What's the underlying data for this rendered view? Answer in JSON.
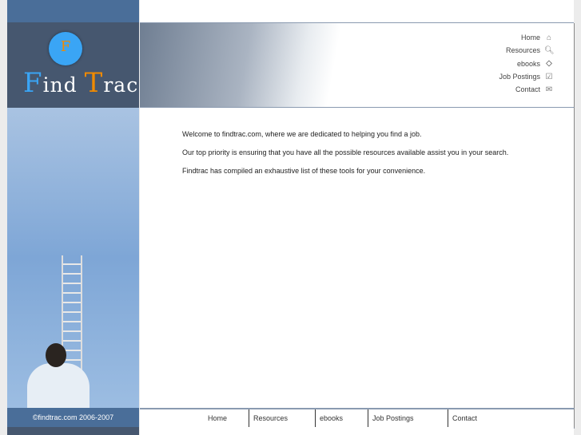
{
  "brand": {
    "logo_letter": "F",
    "name_first": "F",
    "name_rest1": "ind",
    "name_second": "T",
    "name_rest2": "rac"
  },
  "nav": [
    {
      "label": "Home",
      "icon": "home-icon"
    },
    {
      "label": "Resources",
      "icon": "search-icon"
    },
    {
      "label": "ebooks",
      "icon": "book-icon"
    },
    {
      "label": "Job Postings",
      "icon": "checkbox-icon"
    },
    {
      "label": "Contact",
      "icon": "envelope-icon"
    }
  ],
  "content": [
    "Welcome to findtrac.com, where we are dedicated to helping you find a job.",
    "Our top priority is ensuring that you have all the possible resources available assist you in your search.",
    "Findtrac has compiled an exhaustive list of these tools for your convenience."
  ],
  "footer": {
    "copyright": "©findtrac.com 2006-2007",
    "links": [
      "Home",
      "Resources",
      "ebooks",
      "Job Postings",
      "Contact"
    ]
  }
}
